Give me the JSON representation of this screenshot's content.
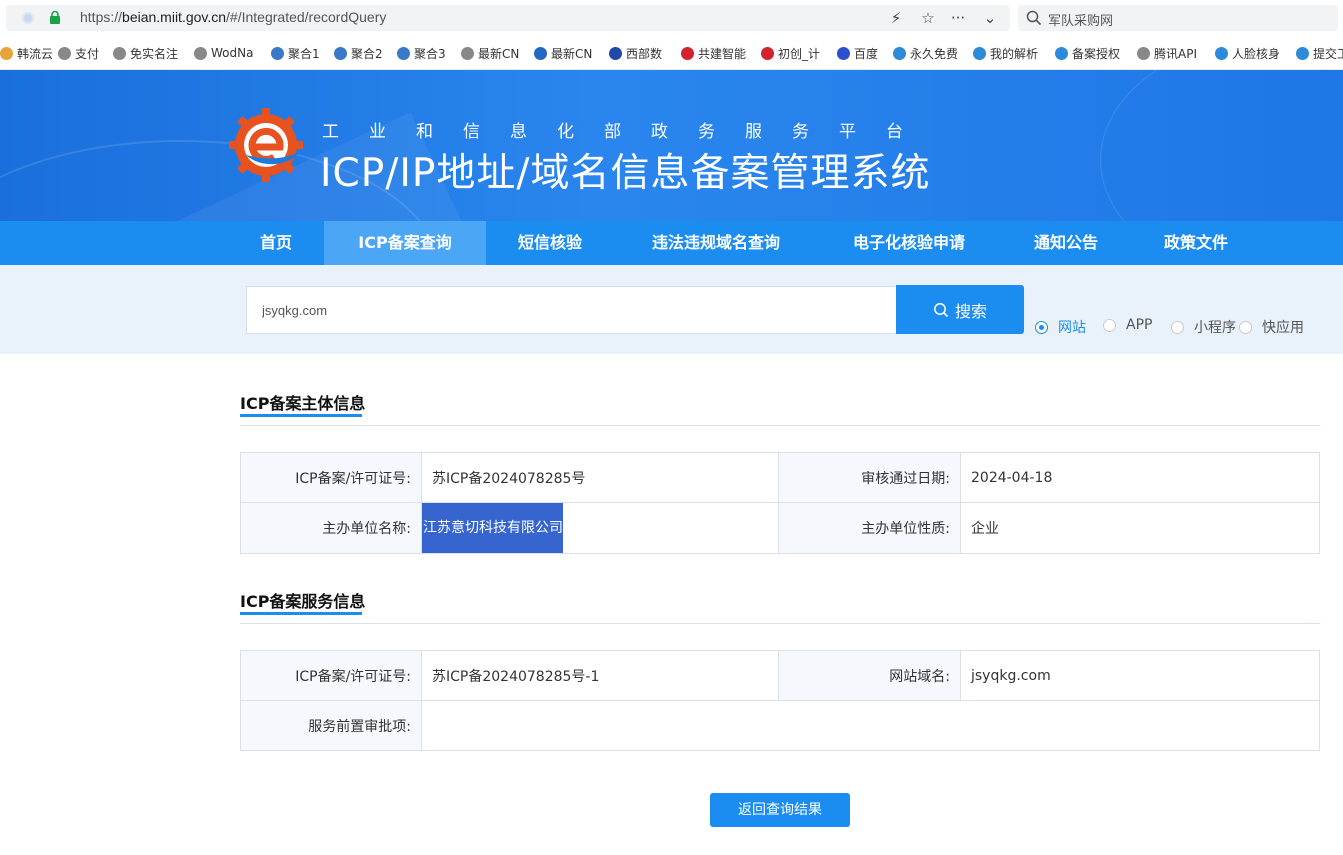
{
  "browser": {
    "url_prefix": "https://",
    "url_host": "beian.miit.gov.cn",
    "url_path": "/#/Integrated/recordQuery",
    "search_text": "军队采购网",
    "tools": [
      "⚡",
      "☆",
      "···",
      "⌄"
    ]
  },
  "bookmarks": [
    {
      "label": "韩流云",
      "color": "#e8a33a"
    },
    {
      "label": "支付",
      "color": "#888888"
    },
    {
      "label": "免实名注",
      "color": "#888888"
    },
    {
      "label": "WodNa",
      "color": "#888888"
    },
    {
      "label": "聚合1",
      "color": "#3a78c9"
    },
    {
      "label": "聚合2",
      "color": "#3a78c9"
    },
    {
      "label": "聚合3",
      "color": "#3a78c9"
    },
    {
      "label": "最新CN",
      "color": "#888888"
    },
    {
      "label": "最新CN",
      "color": "#2366c4"
    },
    {
      "label": "西部数",
      "color": "#1d4aa8"
    },
    {
      "label": "共建智能",
      "color": "#d3242b"
    },
    {
      "label": "初创_计",
      "color": "#d3242b"
    },
    {
      "label": "百度",
      "color": "#2c4fd1"
    },
    {
      "label": "永久免费",
      "color": "#2c8ad8"
    },
    {
      "label": "我的解析",
      "color": "#2c8ad8"
    },
    {
      "label": "备案授权",
      "color": "#2c8ad8"
    },
    {
      "label": "腾讯API",
      "color": "#888888"
    },
    {
      "label": "人脸核身",
      "color": "#2c8ad8"
    },
    {
      "label": "提交工",
      "color": "#2c8ad8"
    }
  ],
  "header": {
    "subtitle": "工业和信息化部政务服务平台",
    "title": "ICP/IP地址/域名信息备案管理系统"
  },
  "nav": {
    "items": [
      "首页",
      "ICP备案查询",
      "短信核验",
      "违法违规域名查询",
      "电子化核验申请",
      "通知公告",
      "政策文件"
    ],
    "active_index": 1
  },
  "search": {
    "value": "jsyqkg.com",
    "button_label": "搜索",
    "options": [
      "网站",
      "APP",
      "小程序",
      "快应用"
    ],
    "selected": "网站"
  },
  "subject_info": {
    "title": "ICP备案主体信息",
    "license_label": "ICP备案/许可证号:",
    "license_value": "苏ICP备2024078285号",
    "approve_date_label": "审核通过日期:",
    "approve_date_value": "2024-04-18",
    "org_name_label": "主办单位名称:",
    "org_name_value": "江苏意切科技有限公司",
    "org_type_label": "主办单位性质:",
    "org_type_value": "企业"
  },
  "service_info": {
    "title": "ICP备案服务信息",
    "license_label": "ICP备案/许可证号:",
    "license_value": "苏ICP备2024078285号-1",
    "domain_label": "网站域名:",
    "domain_value": "jsyqkg.com",
    "pre_approval_label": "服务前置审批项:",
    "pre_approval_value": ""
  },
  "back_button_label": "返回查询结果",
  "colors": {
    "primary": "#1b8cf0",
    "nav_active": "#4ba6f5",
    "highlight": "#3665cf"
  }
}
